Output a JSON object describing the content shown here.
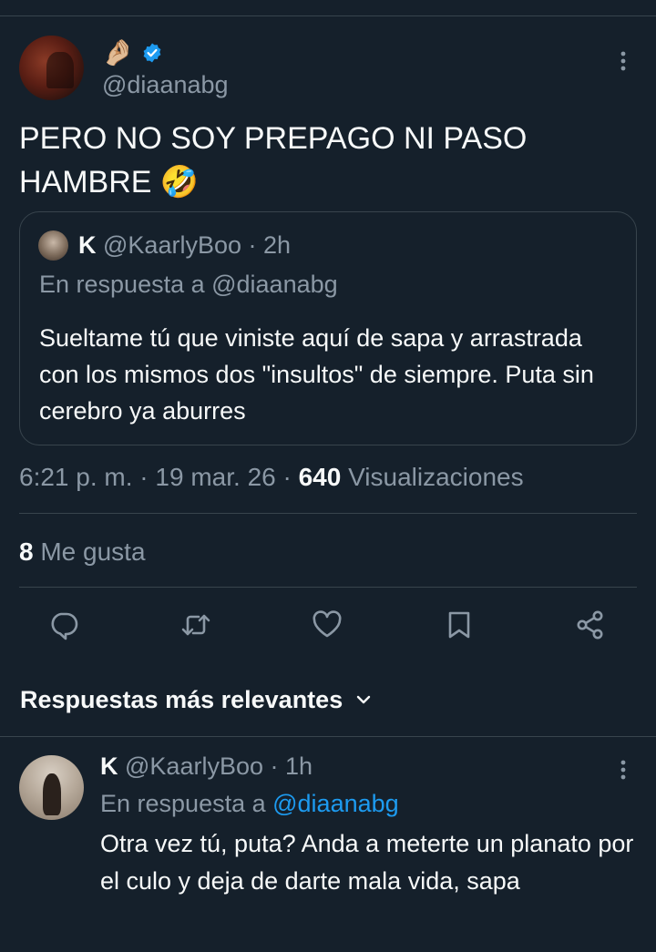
{
  "main_tweet": {
    "display_name_emoji": "🤌🏼",
    "handle": "@diaanabg",
    "text_line1": "PERO NO SOY PREPAGO NI PASO",
    "text_line2": "HAMBRE",
    "text_emoji": "🤣",
    "time": "6:21 p. m.",
    "sep1": " · ",
    "date": "19 mar. 26",
    "sep2": " · ",
    "views_count": "640",
    "views_label": " Visualizaciones",
    "likes_count": "8",
    "likes_label": " Me gusta"
  },
  "quote": {
    "name": "K",
    "handle": "@KaarlyBoo",
    "dot": " · ",
    "time": "2h",
    "reply_to": "En respuesta a @diaanabg",
    "text": "Sueltame tú que viniste aquí de sapa y arrastrada con los mismos dos \"insultos\" de siempre. Puta sin cerebro ya aburres"
  },
  "section": {
    "title": "Respuestas más relevantes"
  },
  "reply": {
    "name": "K",
    "handle": "@KaarlyBoo",
    "dot": " · ",
    "time": "1h",
    "reply_prefix": "En respuesta a ",
    "reply_mention": "@diaanabg",
    "text": "Otra vez tú, puta? Anda a meterte un planato por el culo y deja de darte mala vida, sapa"
  },
  "colors": {
    "background": "#15202b",
    "accent": "#1d9bf0",
    "secondary_text": "#8b98a5",
    "border": "#38444d"
  },
  "icons": [
    "verified-icon",
    "more-icon",
    "reply-icon",
    "retweet-icon",
    "like-icon",
    "bookmark-icon",
    "share-icon",
    "chevron-down-icon"
  ]
}
